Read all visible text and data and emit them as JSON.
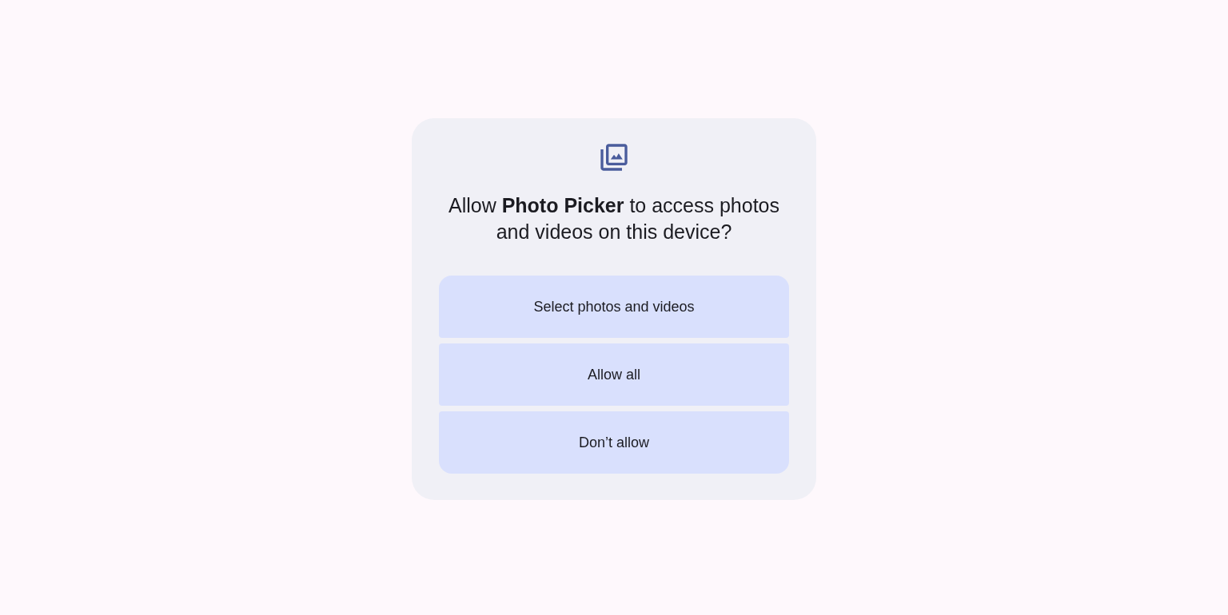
{
  "dialog": {
    "title": "Allow **Photo Picker** to access photos and videos on this device?",
    "buttons": [
      "Select photos and videos",
      "Allow all",
      "Don’t allow"
    ]
  }
}
